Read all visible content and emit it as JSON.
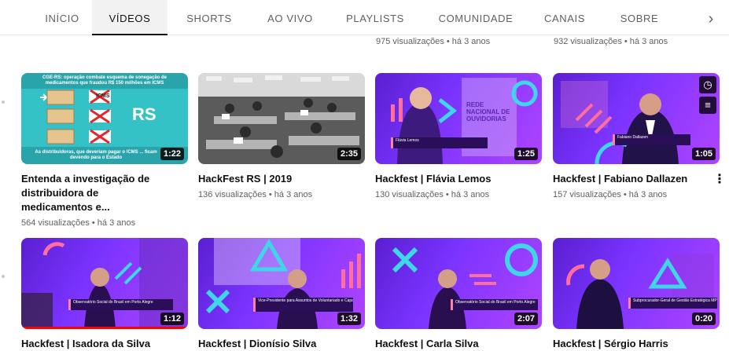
{
  "tabs": {
    "items": [
      {
        "label": "INÍCIO"
      },
      {
        "label": "VÍDEOS"
      },
      {
        "label": "SHORTS"
      },
      {
        "label": "AO VIVO"
      },
      {
        "label": "PLAYLISTS"
      },
      {
        "label": "COMUNIDADE"
      },
      {
        "label": "CANAIS"
      },
      {
        "label": "SOBRE"
      }
    ],
    "active": "VÍDEOS",
    "next_icon": "chevron-right-icon"
  },
  "previous_row_meta": [
    "975 visualizações • há 3 anos",
    "932 visualizações • há 3 anos"
  ],
  "videos": [
    {
      "title": "Entenda a investigação de distribuidora de medicamentos e...",
      "meta": "564 visualizações • há 3 anos",
      "duration": "1:22",
      "thumb_text": {
        "headline": "CGE-RS: operação combate esquema de sonegação de medicamentos que fraudou R$ 150 milhões em ICMS",
        "badge": "RS",
        "stamp": "ICMS",
        "footer": "As distribuidoras, que deveriam pagar o ICMS ... ficam devendo para o Estado"
      }
    },
    {
      "title": "HackFest RS | 2019",
      "meta": "136 visualizações • há 3 anos",
      "duration": "2:35"
    },
    {
      "title": "Hackfest | Flávia Lemos",
      "meta": "130 visualizações • há 3 anos",
      "duration": "1:25",
      "thumb_text": {
        "sign": "REDE NACIONAL DE OUVIDORIAS",
        "caption": "Flávia Lemos"
      }
    },
    {
      "title": "Hackfest | Fabiano Dallazen",
      "meta": "157 visualizações • há 3 anos",
      "duration": "1:05",
      "thumb_text": {
        "caption": "Fabiano Dallazen"
      },
      "hover_icons": [
        "clock-icon",
        "queue-icon"
      ]
    },
    {
      "title": "Hackfest | Isadora da Silva",
      "meta": "",
      "duration": "1:12",
      "thumb_text": {
        "caption": "Observatório Social do Brasil em Porto Alegre"
      },
      "watched_fraction": 1.0
    },
    {
      "title": "Hackfest | Dionísio Silva",
      "meta": "",
      "duration": "1:32",
      "thumb_text": {
        "caption": "Vice-Presidente para Assuntos de Voluntariado e Capacitação do Observatório Social"
      }
    },
    {
      "title": "Hackfest | Carla Silva",
      "meta": "",
      "duration": "2:07",
      "thumb_text": {
        "caption": "Observatório Social do Brasil em Porto Alegre"
      }
    },
    {
      "title": "Hackfest | Sérgio Harris",
      "meta": "",
      "duration": "0:20",
      "thumb_text": {
        "caption": "Subprocurador-Geral de Gestão Estratégica MPRS"
      }
    }
  ],
  "colors": {
    "accent": "#8a2be2",
    "cyan": "#3fd6e8",
    "pink": "#ff6f9c",
    "progress": "#ff0000"
  }
}
